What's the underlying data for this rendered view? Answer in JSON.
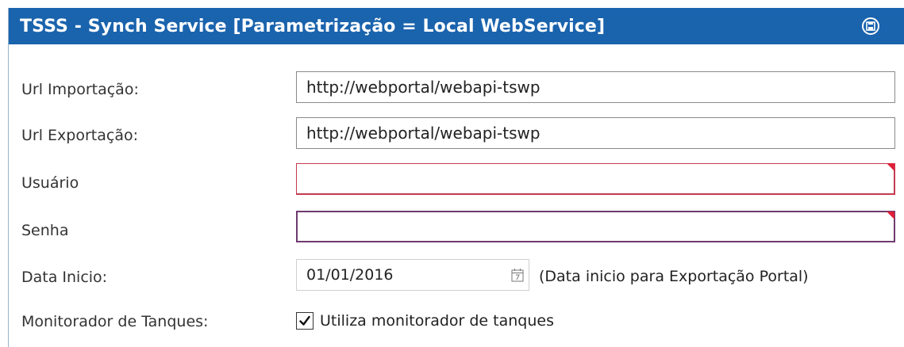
{
  "panel": {
    "title": "TSSS - Synch Service [Parametrização = Local WebService]",
    "save_icon": "save-disk-icon",
    "title_bar_color": "#1a63ad"
  },
  "form": {
    "url_importacao": {
      "label": "Url Importação:",
      "value": "http://webportal/webapi-tswp"
    },
    "url_exportacao": {
      "label": "Url Exportação:",
      "value": "http://webportal/webapi-tswp"
    },
    "usuario": {
      "label": "Usuário",
      "value": ""
    },
    "senha": {
      "label": "Senha",
      "value": ""
    },
    "data_inicio": {
      "label": "Data Inicio:",
      "value": "01/01/2016",
      "hint": "(Data inicio para Exportação Portal)",
      "icon": "calendar-icon"
    },
    "monitorador": {
      "label": "Monitorador de Tanques:",
      "checkbox_label": "Utiliza monitorador de tanques",
      "checked": true
    }
  },
  "colors": {
    "error_red": "#c43a4f",
    "error_purple": "#6e3a6e",
    "error_marker": "#e0203a"
  }
}
